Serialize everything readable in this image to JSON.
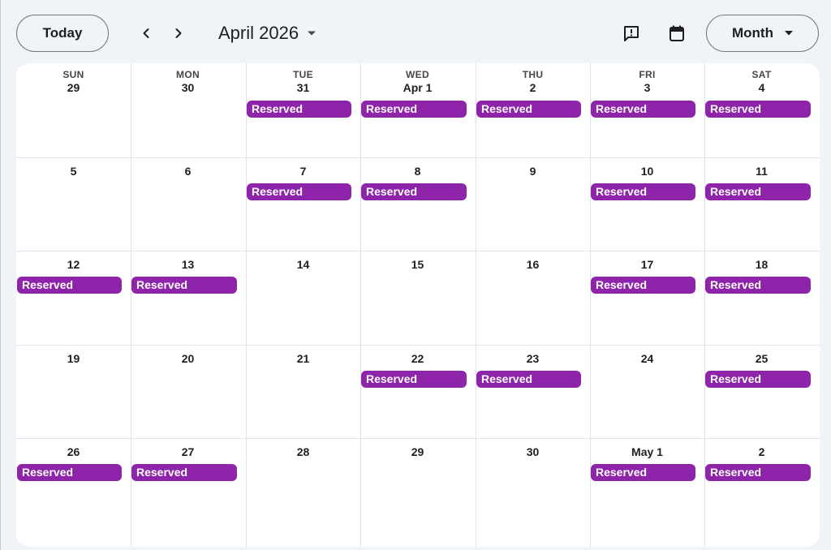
{
  "header": {
    "today_label": "Today",
    "prev_icon": "chevron-left-icon",
    "next_icon": "chevron-right-icon",
    "title": "April 2026",
    "feedback_icon": "feedback-icon",
    "calendar_icon": "calendar-icon",
    "view_label": "Month"
  },
  "colors": {
    "event": "#8e24aa",
    "grid_line": "#dde3ea",
    "background": "#f0f4f9"
  },
  "weekdays": [
    "SUN",
    "MON",
    "TUE",
    "WED",
    "THU",
    "FRI",
    "SAT"
  ],
  "weeks": [
    [
      {
        "label": "29",
        "events": []
      },
      {
        "label": "30",
        "events": []
      },
      {
        "label": "31",
        "events": [
          "Reserved"
        ]
      },
      {
        "label": "Apr 1",
        "events": [
          "Reserved"
        ]
      },
      {
        "label": "2",
        "events": [
          "Reserved"
        ]
      },
      {
        "label": "3",
        "events": [
          "Reserved"
        ]
      },
      {
        "label": "4",
        "events": [
          "Reserved"
        ]
      }
    ],
    [
      {
        "label": "5",
        "events": []
      },
      {
        "label": "6",
        "events": []
      },
      {
        "label": "7",
        "events": [
          "Reserved"
        ]
      },
      {
        "label": "8",
        "events": [
          "Reserved"
        ]
      },
      {
        "label": "9",
        "events": []
      },
      {
        "label": "10",
        "events": [
          "Reserved"
        ]
      },
      {
        "label": "11",
        "events": [
          "Reserved"
        ]
      }
    ],
    [
      {
        "label": "12",
        "events": [
          "Reserved"
        ]
      },
      {
        "label": "13",
        "events": [
          "Reserved"
        ]
      },
      {
        "label": "14",
        "events": []
      },
      {
        "label": "15",
        "events": []
      },
      {
        "label": "16",
        "events": []
      },
      {
        "label": "17",
        "events": [
          "Reserved"
        ]
      },
      {
        "label": "18",
        "events": [
          "Reserved"
        ]
      }
    ],
    [
      {
        "label": "19",
        "events": []
      },
      {
        "label": "20",
        "events": []
      },
      {
        "label": "21",
        "events": []
      },
      {
        "label": "22",
        "events": [
          "Reserved"
        ]
      },
      {
        "label": "23",
        "events": [
          "Reserved"
        ]
      },
      {
        "label": "24",
        "events": []
      },
      {
        "label": "25",
        "events": [
          "Reserved"
        ]
      }
    ],
    [
      {
        "label": "26",
        "events": [
          "Reserved"
        ]
      },
      {
        "label": "27",
        "events": [
          "Reserved"
        ]
      },
      {
        "label": "28",
        "events": []
      },
      {
        "label": "29",
        "events": []
      },
      {
        "label": "30",
        "events": []
      },
      {
        "label": "May 1",
        "events": [
          "Reserved"
        ]
      },
      {
        "label": "2",
        "events": [
          "Reserved"
        ]
      }
    ]
  ]
}
